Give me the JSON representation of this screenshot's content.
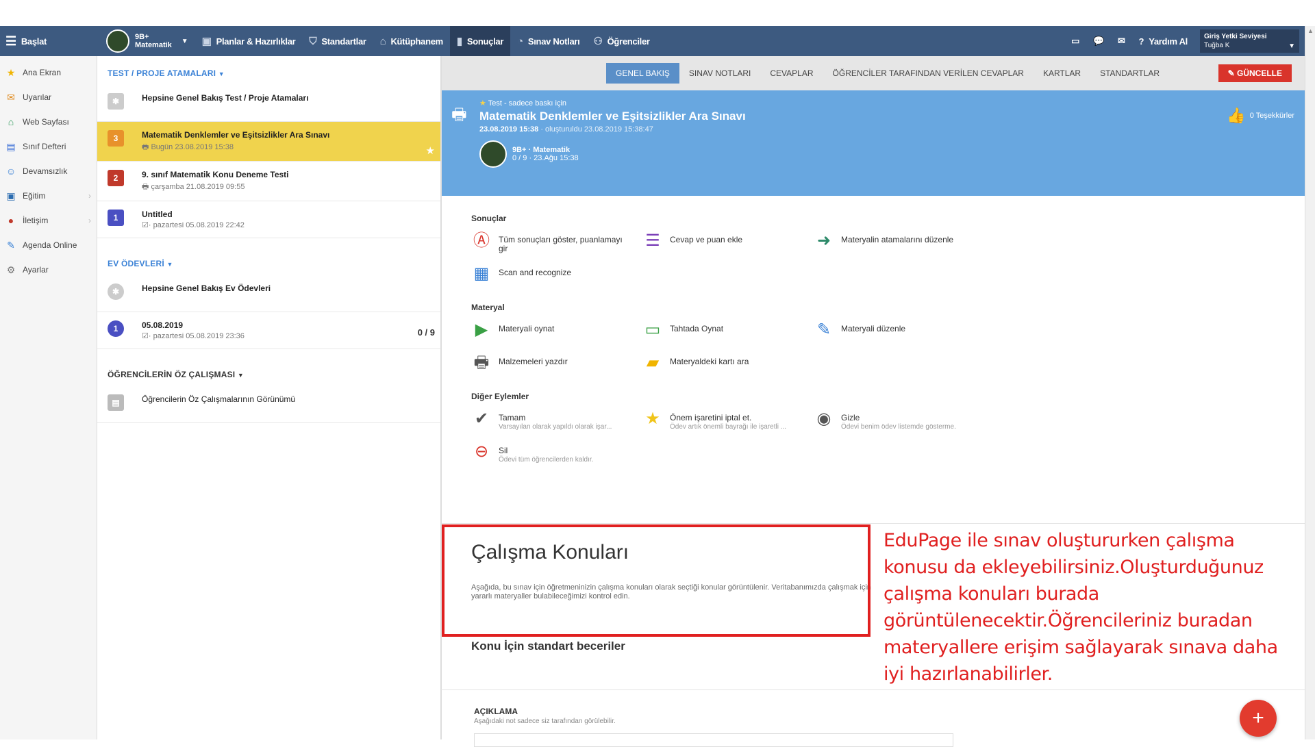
{
  "topbar": {
    "menu_label": "Başlat",
    "class_line1": "9B+",
    "class_line2": "Matematik",
    "items": [
      {
        "label": "Planlar & Hazırlıklar",
        "icon": "briefcase-icon"
      },
      {
        "label": "Standartlar",
        "icon": "shield-icon"
      },
      {
        "label": "Kütüphanem",
        "icon": "library-icon"
      },
      {
        "label": "Sonuçlar",
        "icon": "chart-icon"
      },
      {
        "label": "Sınav Notları",
        "icon": "gauge-icon"
      },
      {
        "label": "Öğrenciler",
        "icon": "students-icon"
      }
    ],
    "help_label": "Yardım Al",
    "user_level": "Giriş Yetki Seviyesi",
    "user_name": "Tuğba K"
  },
  "sidebar": {
    "items": [
      {
        "label": "Ana Ekran",
        "icon": "star-icon",
        "color": "#f0b400"
      },
      {
        "label": "Uyarılar",
        "icon": "envelope-icon",
        "color": "#e08a1e"
      },
      {
        "label": "Web Sayfası",
        "icon": "home-icon",
        "color": "#2e9a5a"
      },
      {
        "label": "Sınıf Defteri",
        "icon": "book-icon",
        "color": "#3b6fd6"
      },
      {
        "label": "Devamsızlık",
        "icon": "person-icon",
        "color": "#3b82d6"
      },
      {
        "label": "Eğitim",
        "icon": "briefcase-icon",
        "color": "#2b6cb0"
      },
      {
        "label": "İletişim",
        "icon": "chat-icon",
        "color": "#c0392b"
      },
      {
        "label": "Agenda Online",
        "icon": "pen-icon",
        "color": "#3b82d6"
      },
      {
        "label": "Ayarlar",
        "icon": "gear-icon",
        "color": "#777777"
      }
    ]
  },
  "assignments": {
    "section_title": "TEST / PROJE ATAMALARI",
    "overview": "Hepsine Genel Bakış Test / Proje Atamaları",
    "items": [
      {
        "num": "3",
        "title": "Matematik Denklemler ve Eşitsizlikler Ara Sınavı",
        "sub": "Bugün 23.08.2019 15:38",
        "color": "#e8912b"
      },
      {
        "num": "2",
        "title": "9. sınıf Matematik Konu Deneme Testi",
        "sub": "çarşamba 21.08.2019 09:55",
        "color": "#c0392b"
      },
      {
        "num": "1",
        "title": "Untitled",
        "sub": "· pazartesi 05.08.2019 22:42",
        "color": "#4a4fc2"
      }
    ]
  },
  "homework": {
    "section_title": "EV ÖDEVLERİ",
    "overview": "Hepsine Genel Bakış Ev Ödevleri",
    "item": {
      "num": "1",
      "title": "05.08.2019",
      "sub": "· pazartesi 05.08.2019 23:36",
      "score": "0 / 9"
    }
  },
  "selfstudy": {
    "section_title": "ÖĞRENCİLERİN ÖZ ÇALIŞMASI",
    "item": "Öğrencilerin Öz Çalışmalarının Görünümü"
  },
  "tabs": [
    "GENEL BAKIŞ",
    "SINAV NOTLARI",
    "CEVAPLAR",
    "ÖĞRENCİLER TARAFINDAN VERİLEN CEVAPLAR",
    "KARTLAR",
    "STANDARTLAR"
  ],
  "update_label": "GÜNCELLE",
  "hero": {
    "type": "Test - sadece baskı için",
    "title": "Matematik Denklemler ve Eşitsizlikler Ara Sınavı",
    "date": "23.08.2019 15:38",
    "created": "· oluşturuldu 23.08.2019 15:38:47",
    "class_name": "9B+ · Matematik",
    "class_info": "0 / 9 · 23.Ağu 15:38",
    "thanks": "0 Teşekkürler"
  },
  "results": {
    "title": "Sonuçlar",
    "actions": [
      {
        "label": "Tüm sonuçları göster, puanlamayı gir",
        "icon": "grade-icon"
      },
      {
        "label": "Cevap ve puan ekle",
        "icon": "checklist-icon"
      },
      {
        "label": "Materyalin atamalarını düzenle",
        "icon": "assign-icon"
      },
      {
        "label": "Scan and recognize",
        "icon": "qr-icon"
      }
    ]
  },
  "material": {
    "title": "Materyal",
    "actions": [
      {
        "label": "Materyali oynat",
        "icon": "play-icon"
      },
      {
        "label": "Tahtada Oynat",
        "icon": "cast-icon"
      },
      {
        "label": "Materyali düzenle",
        "icon": "edit-icon"
      },
      {
        "label": "Malzemeleri yazdır",
        "icon": "printer-icon"
      },
      {
        "label": "Materyaldeki kartı ara",
        "icon": "folder-icon"
      }
    ]
  },
  "other": {
    "title": "Diğer Eylemler",
    "actions": [
      {
        "label": "Tamam",
        "sub": "Varsayılan olarak yapıldı olarak işar...",
        "icon": "check-icon"
      },
      {
        "label": "Önem işaretini iptal et.",
        "sub": "Ödev artık önemli bayrağı ile işaretli ...",
        "icon": "star-icon"
      },
      {
        "label": "Gizle",
        "sub": "Ödevi benim ödev listemde gösterme.",
        "icon": "hide-icon"
      },
      {
        "label": "Sil",
        "sub": "Ödevi tüm öğrencilerden kaldır.",
        "icon": "delete-icon"
      }
    ]
  },
  "topics": {
    "title": "Çalışma Konuları",
    "text": "Aşağıda, bu sınav için öğretmeninizin çalışma konuları olarak seçtiği konular görüntülenir. Veritabanımızda çalışmak için yararlı materyaller bulabileceğimizi kontrol edin.",
    "skills_title": "Konu İçin standart beceriler"
  },
  "callout": "EduPage ile sınav oluştururken çalışma konusu da ekleyebilirsiniz.Oluşturduğunuz çalışma konuları burada görüntülenecektir.Öğrencileriniz buradan materyallere erişim sağlayarak sınava daha iyi hazırlanabilirler.",
  "description": {
    "title": "AÇIKLAMA",
    "sub": "Aşağıdaki not sadece siz tarafından görülebilir."
  },
  "colors": {
    "topbar": "#3d5a80",
    "hero": "#68a7e0",
    "highlight": "#f0d34d",
    "accent_red": "#e02020"
  }
}
